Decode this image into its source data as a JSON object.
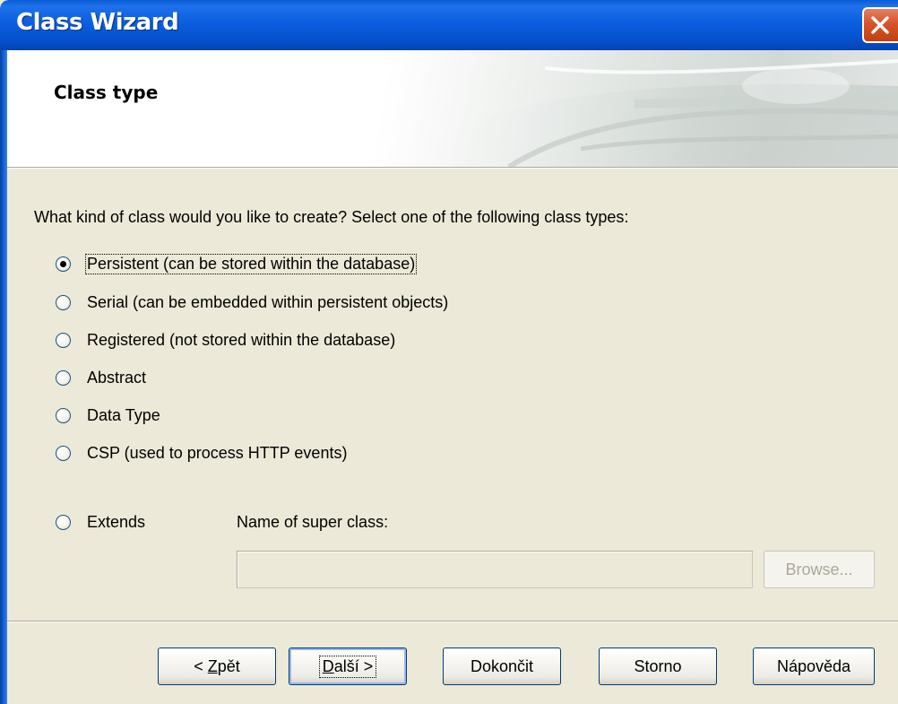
{
  "window": {
    "title": "Class Wizard"
  },
  "header": {
    "title": "Class type"
  },
  "question": "What kind of class would you like to create? Select one of the following class types:",
  "options": [
    {
      "label": "Persistent  (can be stored within the database)",
      "checked": true
    },
    {
      "label": "Serial   (can be embedded within persistent objects)",
      "checked": false
    },
    {
      "label": "Registered  (not stored within the database)",
      "checked": false
    },
    {
      "label": "Abstract",
      "checked": false
    },
    {
      "label": "Data Type",
      "checked": false
    },
    {
      "label": "CSP  (used to process HTTP events)",
      "checked": false
    },
    {
      "label": "Extends",
      "checked": false
    }
  ],
  "super_class": {
    "label": "Name of super class:",
    "value": "",
    "browse_label": "Browse..."
  },
  "buttons": {
    "back_prefix": "< ",
    "back_key": "Z",
    "back_rest": "pět",
    "next_key": "D",
    "next_rest": "alší >",
    "finish": "Dokončit",
    "cancel": "Storno",
    "help": "Nápověda"
  },
  "colors": {
    "titlebar": "#0650cc",
    "dialog_background": "#ece9d8",
    "close_button": "#d6542a"
  }
}
